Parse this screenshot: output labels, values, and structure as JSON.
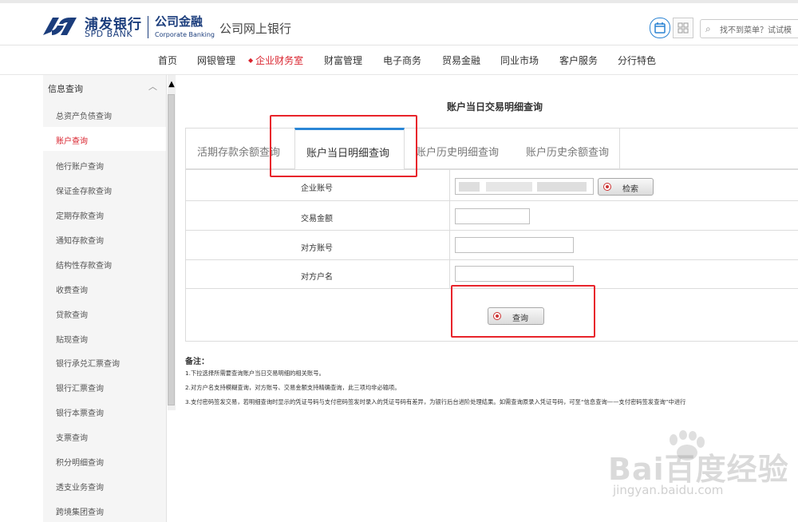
{
  "header": {
    "brand_cn": "浦发银行",
    "brand_en": "SPD BANK",
    "corp_cn": "公司金融",
    "corp_en": "Corporate Banking",
    "title": "公司网上银行",
    "search_placeholder": "找不到菜单？试试模",
    "brand_color": "#1b3d7c"
  },
  "nav": {
    "items": [
      {
        "label": "首页"
      },
      {
        "label": "网银管理"
      },
      {
        "label": "企业财务室",
        "active": true
      },
      {
        "label": "财富管理"
      },
      {
        "label": "电子商务"
      },
      {
        "label": "贸易金融"
      },
      {
        "label": "同业市场"
      },
      {
        "label": "客户服务"
      },
      {
        "label": "分行特色"
      }
    ],
    "active_color": "#d9232e"
  },
  "sidebar": {
    "group_label": "信息查询",
    "items": [
      {
        "label": "总资产负债查询"
      },
      {
        "label": "账户查询",
        "active": true
      },
      {
        "label": "他行账户查询"
      },
      {
        "label": "保证金存款查询"
      },
      {
        "label": "定期存款查询"
      },
      {
        "label": "通知存款查询"
      },
      {
        "label": "结构性存款查询"
      },
      {
        "label": "收费查询"
      },
      {
        "label": "贷款查询"
      },
      {
        "label": "贴现查询"
      },
      {
        "label": "银行承兑汇票查询"
      },
      {
        "label": "银行汇票查询"
      },
      {
        "label": "银行本票查询"
      },
      {
        "label": "支票查询"
      },
      {
        "label": "积分明细查询"
      },
      {
        "label": "透支业务查询"
      },
      {
        "label": "跨境集团查询"
      }
    ]
  },
  "main": {
    "page_title": "账户当日交易明细查询",
    "tabs": [
      {
        "label": "活期存款余额查询"
      },
      {
        "label": "账户当日明细查询",
        "active": true
      },
      {
        "label": "账户历史明细查询"
      },
      {
        "label": "账户历史余额查询"
      }
    ],
    "form": {
      "account_label": "企业账号",
      "search_button": "检索",
      "amount_label": "交易金额",
      "counter_account_label": "对方账号",
      "counter_name_label": "对方户名",
      "query_button": "查询"
    },
    "notes": {
      "title": "备注：",
      "lines": [
        "1.下拉选择所需要查询账户当日交易明细的相关账号。",
        "2.对方户名支持模糊查询，对方账号、交易金额支持精确查询，此三项均非必输项。",
        "3.支付密码签发交易，若明细查询时显示的凭证号码与支付密码签发时录入的凭证号码有差异，为银行后台进阶处理结果。如需查询原录入凭证号码，可至“信息查询——支付密码签发查询”中进行"
      ]
    }
  },
  "watermark": {
    "main": "Bai百度经验",
    "sub": "jingyan.baidu.com"
  },
  "colors": {
    "highlight_red": "#e8242b",
    "tab_accent": "#2a86d6"
  }
}
